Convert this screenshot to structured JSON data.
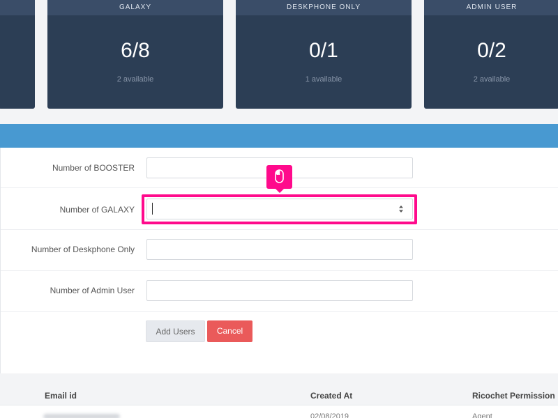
{
  "cards": [
    {
      "title": "GALAXY",
      "value": "6/8",
      "sub": "2 available"
    },
    {
      "title": "DESKPHONE ONLY",
      "value": "0/1",
      "sub": "1 available"
    },
    {
      "title": "ADMIN USER",
      "value": "0/2",
      "sub": "2 available"
    }
  ],
  "form": {
    "booster_label": "Number of BOOSTER",
    "galaxy_label": "Number of GALAXY",
    "deskphone_label": "Number of Deskphone Only",
    "admin_label": "Number of Admin User",
    "add_button": "Add Users",
    "cancel_button": "Cancel"
  },
  "table": {
    "headers": [
      "Email id",
      "Created At",
      "Ricochet Permission"
    ],
    "rows": [
      {
        "created_at": "02/08/2019",
        "permission": "Agent"
      }
    ]
  },
  "colors": {
    "card_bg": "#2c3e55",
    "accent_bar": "#4899d1",
    "highlight": "#ff0a8c",
    "cancel": "#ea5a5a"
  },
  "icons": {
    "tooltip": "mouse-icon",
    "stepper": "stepper-arrows-icon"
  }
}
